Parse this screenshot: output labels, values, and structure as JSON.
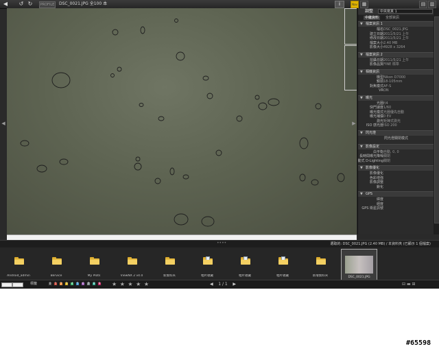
{
  "toolbar": {
    "back_icon": "◀",
    "forward_icon": "↺",
    "refresh_icon": "↻",
    "mode_label": "PROFILE",
    "title": "DSC_0021.JPG 全100 本",
    "info_label": "i",
    "nav_label": "Nav",
    "grid_icons": [
      "▦",
      "▤",
      "▥"
    ],
    "close_icon": "✕"
  },
  "viewer": {
    "left_arrow": "◀",
    "right_arrow": "▶"
  },
  "panel": {
    "header_label": "調整",
    "header_select": "中央寫真 1",
    "tabs": [
      "中繼資料",
      "全部資訊"
    ],
    "sections": [
      {
        "title": "檔案資訊 1",
        "rows": [
          {
            "k": "檔名",
            "v": "DSC_0021.JPG"
          },
          {
            "k": "建立日期",
            "v": "2011/5/21 上午"
          },
          {
            "k": "修改日期",
            "v": "2011/5/21 上午"
          },
          {
            "k": "檔案大小",
            "v": "2.40 MB"
          },
          {
            "k": "影像大小",
            "v": "4928 x 3264"
          }
        ]
      },
      {
        "title": "檔案資訊 2",
        "rows": [
          {
            "k": "拍攝日期",
            "v": "2011/5/21 上午"
          },
          {
            "k": "影像品質",
            "v": "FINE 標準"
          }
        ]
      },
      {
        "title": "相機資訊",
        "rows": [
          {
            "k": "機型",
            "v": "Nikon D7000"
          },
          {
            "k": "鏡頭",
            "v": "18-105mm"
          },
          {
            "k": "對焦模式",
            "v": "AF-S"
          },
          {
            "k": "VR",
            "v": "ON"
          }
        ]
      },
      {
        "title": "曝光",
        "rows": [
          {
            "k": "光圈",
            "v": "f/4"
          },
          {
            "k": "快門速度",
            "v": "1/60"
          },
          {
            "k": "曝光模式",
            "v": "光圈優先自動"
          },
          {
            "k": "曝光補償",
            "v": "0 EV"
          },
          {
            "k": "測光",
            "v": "矩陣式測光"
          },
          {
            "k": "ISO 感光度",
            "v": "ISO 200"
          }
        ]
      },
      {
        "title": "閃光燈",
        "center": "閃光燈關閉模式"
      },
      {
        "title": "影像設定",
        "rows": [
          {
            "k": "白平衡",
            "v": "自動, 0, 0"
          },
          {
            "k": "長時間曝光降噪",
            "v": "關閉"
          },
          {
            "k": "主動式 D-Lighting",
            "v": "關閉"
          }
        ]
      },
      {
        "title": "影像優化",
        "rows": [
          {
            "k": "影像優化",
            "v": ""
          },
          {
            "k": "色彩增強",
            "v": ""
          },
          {
            "k": "影像調整",
            "v": ""
          },
          {
            "k": "銳化",
            "v": ""
          }
        ]
      },
      {
        "title": "GPS",
        "rows": [
          {
            "k": "緯度",
            "v": ""
          },
          {
            "k": "經度",
            "v": ""
          },
          {
            "k": "GPS 衛星訊號",
            "v": ""
          }
        ]
      }
    ]
  },
  "status_line": {
    "text": "選取的: DSC_0021.JPG (2.40 MB) / 本資料夾 (已顯示 1 個檔案)"
  },
  "filmstrip": {
    "folders": [
      {
        "name": "Android_admin",
        "icon": "folder-icon"
      },
      {
        "name": "Bervice",
        "icon": "folder-icon"
      },
      {
        "name": "My Plots",
        "icon": "folder-icon"
      },
      {
        "name": "ViewNX 2 v4.0",
        "icon": "folder-icon"
      },
      {
        "name": "新資料夾",
        "icon": "folder-icon"
      },
      {
        "name": "相片收藏",
        "icon": "folder-image-icon"
      },
      {
        "name": "相片收藏",
        "icon": "folder-image-icon"
      },
      {
        "name": "相片收藏",
        "icon": "folder-image-icon"
      },
      {
        "name": "新增資料夾",
        "icon": "folder-icon"
      }
    ],
    "selected_thumb": "DSC_0021.JPG"
  },
  "bottombar": {
    "label": "標籤",
    "labels": [
      "0",
      "1",
      "2",
      "3",
      "4",
      "5",
      "6",
      "7",
      "8",
      "9"
    ],
    "label_colors": [
      "#444444",
      "#c0392b",
      "#e67e22",
      "#d4ac0d",
      "#27ae60",
      "#2e86c1",
      "#8e44ad",
      "#7f8c8d",
      "#16a085",
      "#c2185b"
    ],
    "stars": "★ ★ ★ ★ ★",
    "page_prev": "◀",
    "page_text": "1 / 1",
    "page_next": "▶",
    "zoom_icons": [
      "⊟",
      "▬",
      "⊞"
    ]
  },
  "watermark": "#65598"
}
